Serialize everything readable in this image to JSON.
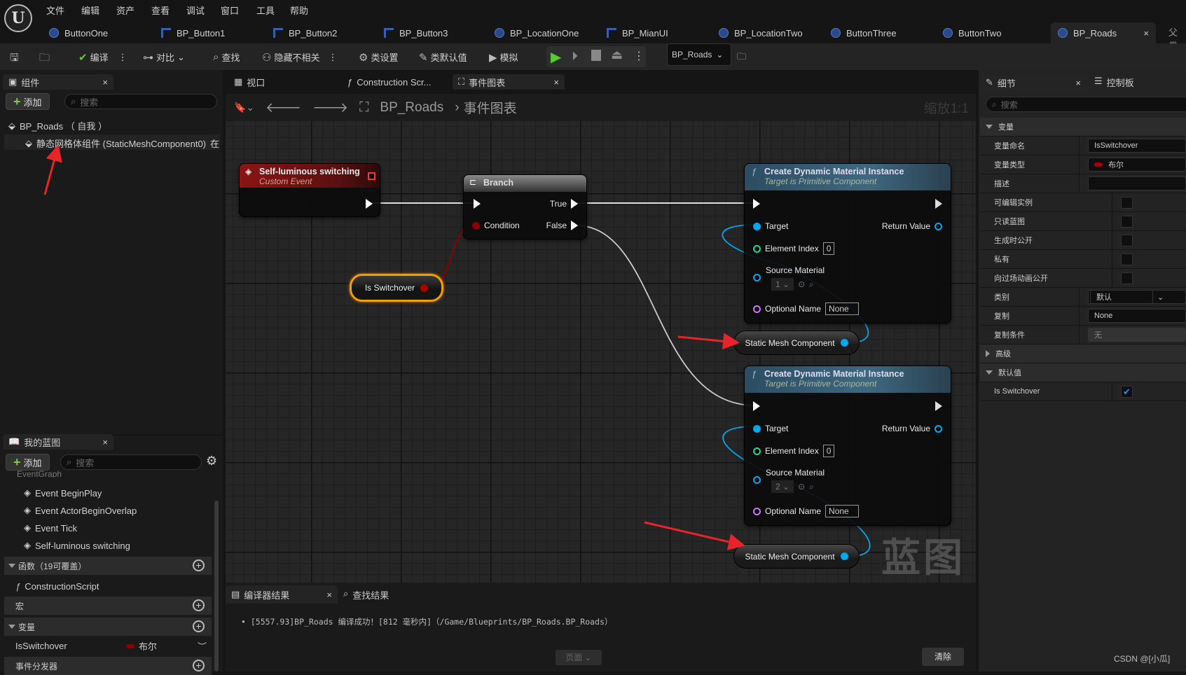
{
  "menu": [
    "文件",
    "编辑",
    "资产",
    "查看",
    "调试",
    "窗口",
    "工具",
    "帮助"
  ],
  "doc_tabs": [
    {
      "label": "ButtonOne",
      "icon": "blueprint-actor-icon"
    },
    {
      "label": "BP_Button1",
      "icon": "widget-blueprint-icon"
    },
    {
      "label": "BP_Button2",
      "icon": "widget-blueprint-icon"
    },
    {
      "label": "BP_Button3",
      "icon": "widget-blueprint-icon"
    },
    {
      "label": "BP_LocationOne",
      "icon": "blueprint-actor-icon"
    },
    {
      "label": "BP_MianUI",
      "icon": "widget-blueprint-icon"
    },
    {
      "label": "BP_LocationTwo",
      "icon": "blueprint-actor-icon"
    },
    {
      "label": "ButtonThree",
      "icon": "blueprint-actor-icon"
    },
    {
      "label": "ButtonTwo",
      "icon": "blueprint-actor-icon"
    },
    {
      "label": "BP_Roads",
      "icon": "blueprint-class-icon",
      "active": true
    }
  ],
  "parent_class_label": "父类",
  "toolbar": {
    "compile": "编译",
    "diff": "对比",
    "find": "查找",
    "hide_unrelated": "隐藏不相关",
    "class_settings": "类设置",
    "class_defaults": "类默认值",
    "simulate": "模拟",
    "debug_object": "BP_Roads"
  },
  "components": {
    "tab": "组件",
    "add": "添加",
    "search_placeholder": "搜索",
    "root": "BP_Roads （ 自我 ）",
    "child": "静态网格体组件 (StaticMeshComponent0)",
    "child_suffix": "在"
  },
  "my_blueprint": {
    "tab": "我的蓝图",
    "add": "添加",
    "search_placeholder": "搜索",
    "graph_partial": "EventGraph",
    "events": [
      "Event BeginPlay",
      "Event ActorBeginOverlap",
      "Event Tick",
      "Self-luminous switching"
    ],
    "functions_header": "函数（19可覆盖）",
    "functions": [
      "ConstructionScript"
    ],
    "macros_header": "宏",
    "variables_header": "变量",
    "variables": [
      {
        "name": "IsSwitchover",
        "type": "布尔",
        "type_color": "#8b0000"
      }
    ],
    "dispatchers_header": "事件分发器"
  },
  "graph_tabs": [
    {
      "label": "视口"
    },
    {
      "label": "Construction Scr..."
    },
    {
      "label": "事件图表",
      "active": true
    }
  ],
  "breadcrumb": {
    "root": "BP_Roads",
    "current": "事件图表",
    "zoom": "缩放1:1"
  },
  "watermark": "蓝图",
  "nodes": {
    "event": {
      "title": "Self-luminous switching",
      "subtitle": "Custom Event"
    },
    "branch": {
      "title": "Branch",
      "true": "True",
      "false": "False",
      "condition": "Condition"
    },
    "getter": {
      "label": "Is Switchover"
    },
    "cdmi": [
      {
        "title": "Create Dynamic Material Instance",
        "subtitle": "Target is Primitive Component",
        "target": "Target",
        "return": "Return Value",
        "element_index": "Element Index",
        "element_value": "0",
        "source_material": "Source Material",
        "source_value": "1",
        "optional_name": "Optional Name",
        "optional_value": "None"
      },
      {
        "title": "Create Dynamic Material Instance",
        "subtitle": "Target is Primitive Component",
        "target": "Target",
        "return": "Return Value",
        "element_index": "Element Index",
        "element_value": "0",
        "source_material": "Source Material",
        "source_value": "2",
        "optional_name": "Optional Name",
        "optional_value": "None"
      }
    ],
    "smc": [
      "Static Mesh Component",
      "Static Mesh Component"
    ]
  },
  "compiler": {
    "tab": "编译器结果",
    "find_tab": "查找结果",
    "message": "[5557.93]BP_Roads 编译成功！[812 毫秒内]（/Game/Blueprints/BP_Roads.BP_Roads）",
    "page": "页面",
    "clear": "清除"
  },
  "details": {
    "tab": "细节",
    "palette_tab": "控制板",
    "search_placeholder": "搜索",
    "variables_header": "变量",
    "rows": [
      {
        "label": "变量命名",
        "type": "text",
        "value": "IsSwitchover"
      },
      {
        "label": "变量类型",
        "type": "pintype",
        "value": "布尔"
      },
      {
        "label": "描述",
        "type": "text",
        "value": ""
      },
      {
        "label": "可编辑实例",
        "type": "check",
        "value": false
      },
      {
        "label": "只读蓝图",
        "type": "check",
        "value": false
      },
      {
        "label": "生成时公开",
        "type": "check",
        "value": false
      },
      {
        "label": "私有",
        "type": "check",
        "value": false
      },
      {
        "label": "向过场动画公开",
        "type": "check",
        "value": false
      },
      {
        "label": "类别",
        "type": "combo",
        "value": "默认"
      },
      {
        "label": "复制",
        "type": "select",
        "value": "None"
      },
      {
        "label": "复制条件",
        "type": "select-disabled",
        "value": "无"
      }
    ],
    "advanced_header": "高级",
    "defaults_header": "默认值",
    "default_rows": [
      {
        "label": "Is Switchover",
        "type": "check",
        "value": true
      }
    ]
  },
  "credit": "CSDN @[小瓜]",
  "colors": {
    "exec": "#ffffff",
    "bool_pin": "#8b0000",
    "object_pin": "#00a8f0",
    "int_pin": "#1fd6a0",
    "name_pin": "#c879ff",
    "annotation_arrow": "#e8242a",
    "event_header": "#8a1515",
    "function_header": "#2d4c62"
  }
}
